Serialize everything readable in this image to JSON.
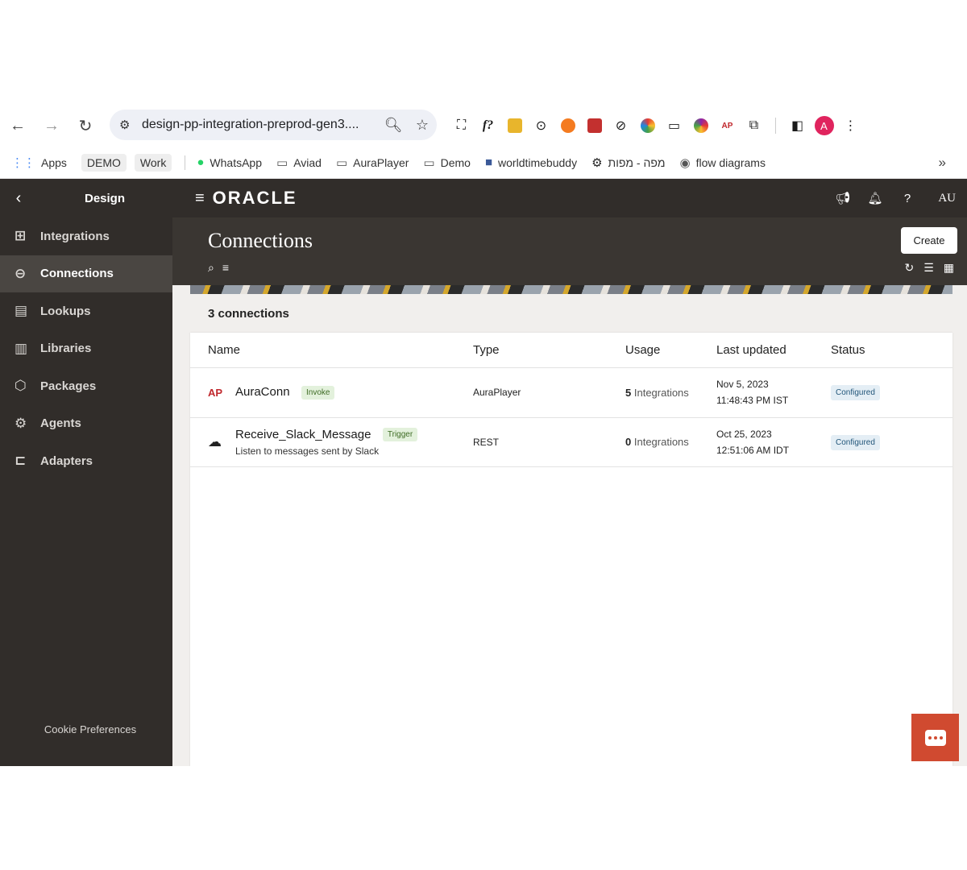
{
  "browser": {
    "url": "design-pp-integration-preprod-gen3....",
    "profile_initial": "A"
  },
  "bookmarks": {
    "items": [
      {
        "label": "Apps",
        "icon": "apps-grid-icon"
      },
      {
        "label": "DEMO",
        "icon": ""
      },
      {
        "label": "Work",
        "icon": ""
      },
      {
        "label": "WhatsApp",
        "icon": "whatsapp-icon"
      },
      {
        "label": "Aviad",
        "icon": "folder-icon"
      },
      {
        "label": "AuraPlayer",
        "icon": "folder-icon"
      },
      {
        "label": "Demo",
        "icon": "folder-icon"
      },
      {
        "label": "worldtimebuddy",
        "icon": "clock-icon"
      },
      {
        "label": "מפה - מפות",
        "icon": "gear-icon"
      },
      {
        "label": "flow diagrams",
        "icon": "globe-icon"
      }
    ],
    "more": "»"
  },
  "header": {
    "section_title": "Design",
    "logo": "ORACLE",
    "user": "AU"
  },
  "sidebar": {
    "items": [
      {
        "label": "Integrations",
        "icon": "integrations-icon",
        "active": false
      },
      {
        "label": "Connections",
        "icon": "connections-icon",
        "active": true
      },
      {
        "label": "Lookups",
        "icon": "lookups-icon",
        "active": false
      },
      {
        "label": "Libraries",
        "icon": "libraries-icon",
        "active": false
      },
      {
        "label": "Packages",
        "icon": "packages-icon",
        "active": false
      },
      {
        "label": "Agents",
        "icon": "agents-icon",
        "active": false
      },
      {
        "label": "Adapters",
        "icon": "adapters-icon",
        "active": false
      }
    ],
    "cookie": "Cookie Preferences"
  },
  "page": {
    "title": "Connections",
    "create_label": "Create",
    "count_label": "3 connections"
  },
  "table": {
    "columns": [
      "Name",
      "Type",
      "Usage",
      "Last updated",
      "Status"
    ],
    "rows": [
      {
        "name": "AuraConn",
        "role": "Invoke",
        "description": "",
        "type": "AuraPlayer",
        "usage_count": "5",
        "usage_unit": "Integrations",
        "date": "Nov 5, 2023",
        "time": "11:48:43 PM IST",
        "status": "Configured",
        "icon_text": "AP"
      },
      {
        "name": "Receive_Slack_Message",
        "role": "Trigger",
        "description": "Listen to messages sent by Slack",
        "type": "REST",
        "usage_count": "0",
        "usage_unit": "Integrations",
        "date": "Oct 25, 2023",
        "time": "12:51:06 AM IDT",
        "status": "Configured",
        "icon_text": "☁"
      }
    ]
  },
  "colors": {
    "sidebar_bg": "#312d2a",
    "accent_chat": "#d04a30"
  }
}
